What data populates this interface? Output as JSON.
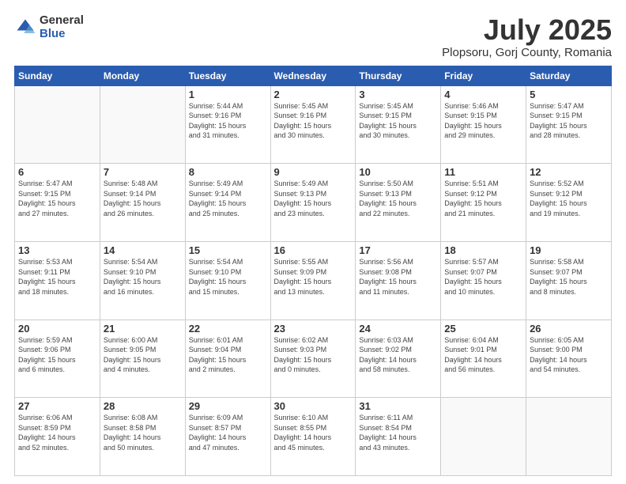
{
  "header": {
    "logo_general": "General",
    "logo_blue": "Blue",
    "title": "July 2025",
    "subtitle": "Plopsoru, Gorj County, Romania"
  },
  "days_of_week": [
    "Sunday",
    "Monday",
    "Tuesday",
    "Wednesday",
    "Thursday",
    "Friday",
    "Saturday"
  ],
  "weeks": [
    [
      {
        "day": "",
        "info": ""
      },
      {
        "day": "",
        "info": ""
      },
      {
        "day": "1",
        "info": "Sunrise: 5:44 AM\nSunset: 9:16 PM\nDaylight: 15 hours\nand 31 minutes."
      },
      {
        "day": "2",
        "info": "Sunrise: 5:45 AM\nSunset: 9:16 PM\nDaylight: 15 hours\nand 30 minutes."
      },
      {
        "day": "3",
        "info": "Sunrise: 5:45 AM\nSunset: 9:15 PM\nDaylight: 15 hours\nand 30 minutes."
      },
      {
        "day": "4",
        "info": "Sunrise: 5:46 AM\nSunset: 9:15 PM\nDaylight: 15 hours\nand 29 minutes."
      },
      {
        "day": "5",
        "info": "Sunrise: 5:47 AM\nSunset: 9:15 PM\nDaylight: 15 hours\nand 28 minutes."
      }
    ],
    [
      {
        "day": "6",
        "info": "Sunrise: 5:47 AM\nSunset: 9:15 PM\nDaylight: 15 hours\nand 27 minutes."
      },
      {
        "day": "7",
        "info": "Sunrise: 5:48 AM\nSunset: 9:14 PM\nDaylight: 15 hours\nand 26 minutes."
      },
      {
        "day": "8",
        "info": "Sunrise: 5:49 AM\nSunset: 9:14 PM\nDaylight: 15 hours\nand 25 minutes."
      },
      {
        "day": "9",
        "info": "Sunrise: 5:49 AM\nSunset: 9:13 PM\nDaylight: 15 hours\nand 23 minutes."
      },
      {
        "day": "10",
        "info": "Sunrise: 5:50 AM\nSunset: 9:13 PM\nDaylight: 15 hours\nand 22 minutes."
      },
      {
        "day": "11",
        "info": "Sunrise: 5:51 AM\nSunset: 9:12 PM\nDaylight: 15 hours\nand 21 minutes."
      },
      {
        "day": "12",
        "info": "Sunrise: 5:52 AM\nSunset: 9:12 PM\nDaylight: 15 hours\nand 19 minutes."
      }
    ],
    [
      {
        "day": "13",
        "info": "Sunrise: 5:53 AM\nSunset: 9:11 PM\nDaylight: 15 hours\nand 18 minutes."
      },
      {
        "day": "14",
        "info": "Sunrise: 5:54 AM\nSunset: 9:10 PM\nDaylight: 15 hours\nand 16 minutes."
      },
      {
        "day": "15",
        "info": "Sunrise: 5:54 AM\nSunset: 9:10 PM\nDaylight: 15 hours\nand 15 minutes."
      },
      {
        "day": "16",
        "info": "Sunrise: 5:55 AM\nSunset: 9:09 PM\nDaylight: 15 hours\nand 13 minutes."
      },
      {
        "day": "17",
        "info": "Sunrise: 5:56 AM\nSunset: 9:08 PM\nDaylight: 15 hours\nand 11 minutes."
      },
      {
        "day": "18",
        "info": "Sunrise: 5:57 AM\nSunset: 9:07 PM\nDaylight: 15 hours\nand 10 minutes."
      },
      {
        "day": "19",
        "info": "Sunrise: 5:58 AM\nSunset: 9:07 PM\nDaylight: 15 hours\nand 8 minutes."
      }
    ],
    [
      {
        "day": "20",
        "info": "Sunrise: 5:59 AM\nSunset: 9:06 PM\nDaylight: 15 hours\nand 6 minutes."
      },
      {
        "day": "21",
        "info": "Sunrise: 6:00 AM\nSunset: 9:05 PM\nDaylight: 15 hours\nand 4 minutes."
      },
      {
        "day": "22",
        "info": "Sunrise: 6:01 AM\nSunset: 9:04 PM\nDaylight: 15 hours\nand 2 minutes."
      },
      {
        "day": "23",
        "info": "Sunrise: 6:02 AM\nSunset: 9:03 PM\nDaylight: 15 hours\nand 0 minutes."
      },
      {
        "day": "24",
        "info": "Sunrise: 6:03 AM\nSunset: 9:02 PM\nDaylight: 14 hours\nand 58 minutes."
      },
      {
        "day": "25",
        "info": "Sunrise: 6:04 AM\nSunset: 9:01 PM\nDaylight: 14 hours\nand 56 minutes."
      },
      {
        "day": "26",
        "info": "Sunrise: 6:05 AM\nSunset: 9:00 PM\nDaylight: 14 hours\nand 54 minutes."
      }
    ],
    [
      {
        "day": "27",
        "info": "Sunrise: 6:06 AM\nSunset: 8:59 PM\nDaylight: 14 hours\nand 52 minutes."
      },
      {
        "day": "28",
        "info": "Sunrise: 6:08 AM\nSunset: 8:58 PM\nDaylight: 14 hours\nand 50 minutes."
      },
      {
        "day": "29",
        "info": "Sunrise: 6:09 AM\nSunset: 8:57 PM\nDaylight: 14 hours\nand 47 minutes."
      },
      {
        "day": "30",
        "info": "Sunrise: 6:10 AM\nSunset: 8:55 PM\nDaylight: 14 hours\nand 45 minutes."
      },
      {
        "day": "31",
        "info": "Sunrise: 6:11 AM\nSunset: 8:54 PM\nDaylight: 14 hours\nand 43 minutes."
      },
      {
        "day": "",
        "info": ""
      },
      {
        "day": "",
        "info": ""
      }
    ]
  ]
}
